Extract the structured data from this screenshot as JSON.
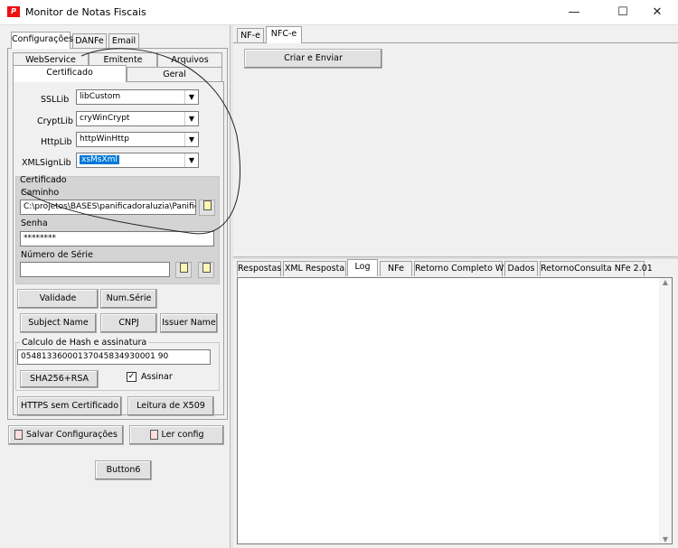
{
  "window": {
    "title": "Monitor de Notas Fiscais",
    "app_icon_text": "P",
    "controls": {
      "minimize": "—",
      "maximize": "☐",
      "close": "✕"
    }
  },
  "left": {
    "top_tabs": [
      "Configurações",
      "DANFe",
      "Email"
    ],
    "sub_tabs_row1": [
      "WebService",
      "Emitente",
      "Arquivos"
    ],
    "sub_tabs_row2": [
      "Certificado",
      "Geral"
    ],
    "ssllib": {
      "label": "SSLLib",
      "value": "libCustom"
    },
    "cryptlib": {
      "label": "CryptLib",
      "value": "cryWinCrypt"
    },
    "httplib": {
      "label": "HttpLib",
      "value": "httpWinHttp"
    },
    "xmlsignlib": {
      "label": "XMLSignLib",
      "value": "xsMsXml"
    },
    "cert_group": {
      "title": "Certificado",
      "caminho_label": "Caminho",
      "caminho_value": "C:\\projetos\\BASES\\panificadoraluzia\\Panifica",
      "senha_label": "Senha",
      "senha_value": "********",
      "numserie_label": "Número de Série",
      "numserie_value": ""
    },
    "buttons": {
      "validade": "Validade",
      "numserie": "Num.Série",
      "subject": "Subject Name",
      "cnpj": "CNPJ",
      "issuer": "Issuer Name"
    },
    "hash_group": {
      "title": "Calculo de Hash e assinatura",
      "value": "05481336000137045834930001 90",
      "sha_button": "SHA256+RSA",
      "assinar_label": "Assinar",
      "assinar_checked": "✓"
    },
    "https_button": "HTTPS sem Certificado",
    "leitura_button": "Leitura de X509",
    "salvar_button": "Salvar Configurações",
    "ler_button": "Ler config",
    "button6": "Button6"
  },
  "right": {
    "top_tabs": [
      "NF-e",
      "NFC-e"
    ],
    "criar_button": "Criar e Enviar",
    "bottom_tabs": [
      "Respostas",
      "XML Resposta",
      "Log",
      "NFe",
      "Retorno Completo WS",
      "Dados",
      "RetornoConsulta NFe 2.01"
    ]
  }
}
